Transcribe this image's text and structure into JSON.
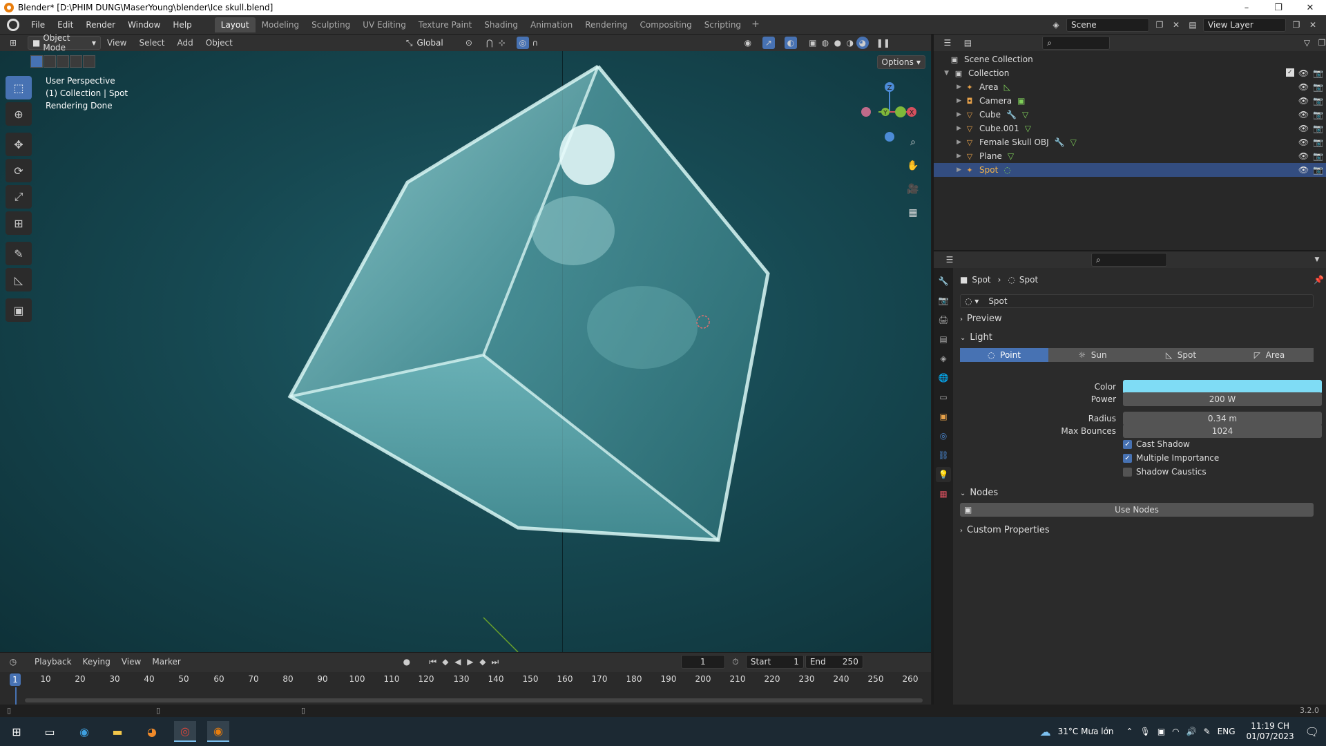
{
  "titlebar": {
    "title": "Blender* [D:\\PHIM DUNG\\MaserYoung\\blender\\Ice skull.blend]",
    "minimize": "–",
    "restore": "❐",
    "close": "✕"
  },
  "menu": [
    "File",
    "Edit",
    "Render",
    "Window",
    "Help"
  ],
  "workspaces": [
    "Layout",
    "Modeling",
    "Sculpting",
    "UV Editing",
    "Texture Paint",
    "Shading",
    "Animation",
    "Rendering",
    "Compositing",
    "Scripting"
  ],
  "workspace_add": "+",
  "scene": {
    "name": "Scene",
    "view_layer": "View Layer"
  },
  "viewport_header": {
    "mode": "Object Mode",
    "menus": [
      "View",
      "Select",
      "Add",
      "Object"
    ],
    "orientation": "Global",
    "options": "Options"
  },
  "viewport": {
    "line1": "User Perspective",
    "line2": "(1) Collection | Spot",
    "line3": "Rendering Done"
  },
  "gizmo": {
    "x": "X",
    "y": "Y",
    "z": "Z"
  },
  "outliner": {
    "scene_collection": "Scene Collection",
    "collection": "Collection",
    "items": [
      {
        "name": "Area",
        "icon": "light-icon",
        "color": "#e8a24a"
      },
      {
        "name": "Camera",
        "icon": "camera-icon",
        "color": "#e8a24a"
      },
      {
        "name": "Cube",
        "icon": "mesh-icon",
        "color": "#e8a24a"
      },
      {
        "name": "Cube.001",
        "icon": "mesh-icon",
        "color": "#e8a24a"
      },
      {
        "name": "Female Skull OBJ",
        "icon": "mesh-icon",
        "color": "#e8a24a"
      },
      {
        "name": "Plane",
        "icon": "mesh-icon",
        "color": "#e8a24a"
      },
      {
        "name": "Spot",
        "icon": "light-icon",
        "color": "#e8a24a",
        "selected": true
      }
    ]
  },
  "properties": {
    "breadcrumb_object": "Spot",
    "breadcrumb_data": "Spot",
    "data_name": "Spot",
    "sections": {
      "preview": "Preview",
      "light": "Light",
      "nodes": "Nodes",
      "custom": "Custom Properties"
    },
    "light_types": [
      "Point",
      "Sun",
      "Spot",
      "Area"
    ],
    "active_light_type": "Point",
    "color_label": "Color",
    "color_value": "#7fdcf5",
    "power_label": "Power",
    "power_value": "200 W",
    "radius_label": "Radius",
    "radius_value": "0.34 m",
    "bounces_label": "Max Bounces",
    "bounces_value": "1024",
    "cast_shadow": "Cast Shadow",
    "multiple_importance": "Multiple Importance",
    "shadow_caustics": "Shadow Caustics",
    "use_nodes": "Use Nodes"
  },
  "timeline": {
    "menus": [
      "Playback",
      "Keying",
      "View",
      "Marker"
    ],
    "current_frame": "1",
    "start_label": "Start",
    "start_value": "1",
    "end_label": "End",
    "end_value": "250",
    "ticks": [
      "10",
      "20",
      "30",
      "40",
      "50",
      "60",
      "70",
      "80",
      "90",
      "100",
      "110",
      "120",
      "130",
      "140",
      "150",
      "160",
      "170",
      "180",
      "190",
      "200",
      "210",
      "220",
      "230",
      "240",
      "250",
      "260"
    ],
    "cursor_frame": "1"
  },
  "statusbar": {
    "version": "3.2.0"
  },
  "taskbar": {
    "weather": "31°C  Mưa lớn",
    "lang": "ENG",
    "time": "11:19 CH",
    "date": "01/07/2023"
  },
  "accent": "#4772b3"
}
